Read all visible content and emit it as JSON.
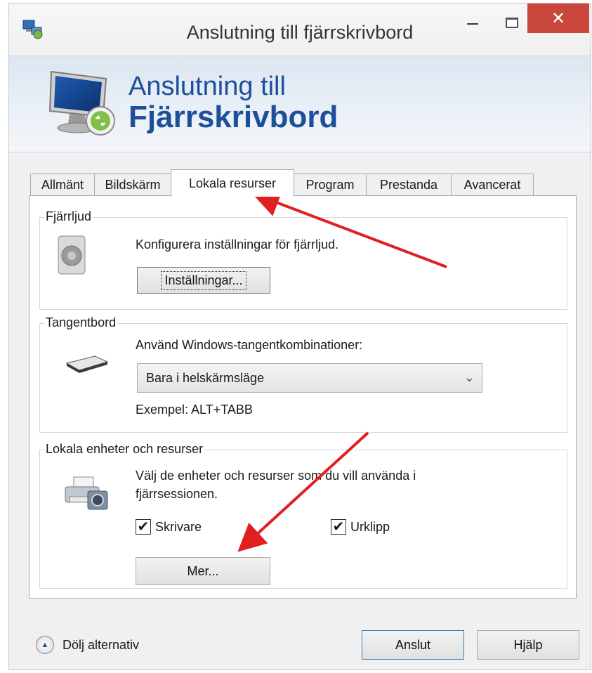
{
  "window": {
    "title": "Anslutning till fjärrskrivbord",
    "minimize_glyph": "–",
    "close_glyph": "✕"
  },
  "banner": {
    "line1": "Anslutning till",
    "line2": "Fjärrskrivbord"
  },
  "tabs": [
    {
      "label": "Allmänt",
      "active": false
    },
    {
      "label": "Bildskärm",
      "active": false
    },
    {
      "label": "Lokala resurser",
      "active": true
    },
    {
      "label": "Program",
      "active": false
    },
    {
      "label": "Prestanda",
      "active": false
    },
    {
      "label": "Avancerat",
      "active": false
    }
  ],
  "remote_audio": {
    "legend": "Fjärrljud",
    "description": "Konfigurera inställningar för fjärrljud.",
    "settings_button": "Inställningar..."
  },
  "keyboard": {
    "legend": "Tangentbord",
    "prompt": "Använd Windows-tangentkombinationer:",
    "selected_option": "Bara i helskärmsläge",
    "example": "Exempel: ALT+TABB"
  },
  "local_devices": {
    "legend": "Lokala enheter och resurser",
    "description_line1": "Välj de enheter och resurser som du vill använda i",
    "description_line2": "fjärrsessionen.",
    "printers_label": "Skrivare",
    "printers_checked": true,
    "clipboard_label": "Urklipp",
    "clipboard_checked": true,
    "more_button": "Mer..."
  },
  "footer": {
    "hide_options": "Dölj alternativ",
    "connect_button": "Anslut",
    "help_button": "Hjälp"
  },
  "colors": {
    "banner_text": "#1d4f9a",
    "close_button": "#c9473b",
    "annotation_arrow": "#e02020"
  },
  "icons": {
    "app": "remote-desktop-icon",
    "banner": "monitor-connection-icon",
    "audio": "speaker-icon",
    "keyboard": "keyboard-icon",
    "devices": "printer-camera-icon"
  }
}
